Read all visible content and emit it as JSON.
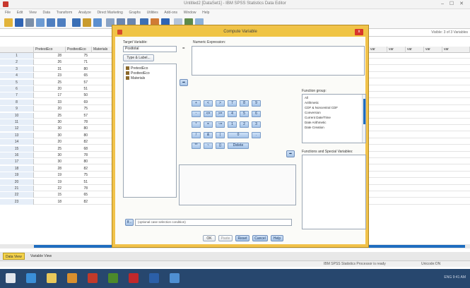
{
  "window": {
    "title": "Untitled2 [DataSet1] - IBM SPSS Statistics Data Editor",
    "controls": "– ☐ ✕"
  },
  "menu": [
    "File",
    "Edit",
    "View",
    "Data",
    "Transform",
    "Analyze",
    "Direct Marketing",
    "Graphs",
    "Utilities",
    "Add-ons",
    "Window",
    "Help"
  ],
  "refbar": {
    "visible": "Visible: 3 of 3 Variables"
  },
  "grid": {
    "columns": [
      "PretestEco",
      "PosttestEco",
      "Materials"
    ],
    "rows": [
      {
        "n": "1",
        "a": "28",
        "b": "75"
      },
      {
        "n": "2",
        "a": "26",
        "b": "71"
      },
      {
        "n": "3",
        "a": "31",
        "b": "80"
      },
      {
        "n": "4",
        "a": "23",
        "b": "65"
      },
      {
        "n": "5",
        "a": "25",
        "b": "57"
      },
      {
        "n": "6",
        "a": "20",
        "b": "51"
      },
      {
        "n": "7",
        "a": "17",
        "b": "50"
      },
      {
        "n": "8",
        "a": "33",
        "b": "69"
      },
      {
        "n": "9",
        "a": "20",
        "b": "75"
      },
      {
        "n": "10",
        "a": "25",
        "b": "57"
      },
      {
        "n": "11",
        "a": "30",
        "b": "78"
      },
      {
        "n": "12",
        "a": "30",
        "b": "80"
      },
      {
        "n": "13",
        "a": "30",
        "b": "80"
      },
      {
        "n": "14",
        "a": "20",
        "b": "82"
      },
      {
        "n": "15",
        "a": "25",
        "b": "68"
      },
      {
        "n": "16",
        "a": "30",
        "b": "78"
      },
      {
        "n": "17",
        "a": "30",
        "b": "80"
      },
      {
        "n": "18",
        "a": "28",
        "b": "82"
      },
      {
        "n": "19",
        "a": "19",
        "b": "75"
      },
      {
        "n": "20",
        "a": "19",
        "b": "51"
      },
      {
        "n": "21",
        "a": "22",
        "b": "78"
      },
      {
        "n": "22",
        "a": "15",
        "b": "65"
      },
      {
        "n": "23",
        "a": "18",
        "b": "82"
      }
    ]
  },
  "view_tabs": [
    "Data View",
    "Variable View"
  ],
  "status": {
    "processor": "IBM SPSS Statistics Processor is ready",
    "unicode": "Unicode:ON"
  },
  "taskbar": {
    "tray": "ENG  9:41 AM"
  },
  "dialog": {
    "title": "Compute Variable",
    "close": "x",
    "target_label": "Target Variable:",
    "target_value": "Posttotal",
    "type_label_button": "Type & Label...",
    "numeric_label": "Numeric Expression:",
    "equals": "=",
    "variables": [
      "PretestEco",
      "PosttestEco",
      "Materials"
    ],
    "move_arrow": "➡",
    "keypad": [
      [
        "+",
        "<",
        ">",
        "7",
        "8",
        "9"
      ],
      [
        "-",
        "<=",
        ">=",
        "4",
        "5",
        "6"
      ],
      [
        "*",
        "=",
        "~=",
        "1",
        "2",
        "3"
      ],
      [
        "/",
        "&",
        "|",
        "0",
        "."
      ],
      [
        "**",
        "~",
        "()",
        "Delete"
      ]
    ],
    "function_group_label": "Function group:",
    "function_groups": [
      "All",
      "Arithmetic",
      "CDF & Noncentral CDF",
      "Conversion",
      "Current Date/Time",
      "Date Arithmetic",
      "Date Creation"
    ],
    "functions_label": "Functions and Special Variables:",
    "if_button": "If...",
    "if_hint": "(optional case selection condition)",
    "buttons": {
      "ok": "OK",
      "paste": "Paste",
      "reset": "Reset",
      "cancel": "Cancel",
      "help": "Help"
    }
  },
  "colors": {
    "dialog_border": "#f1c24a",
    "close": "#d9362b",
    "accent": "#1f6dbf"
  }
}
